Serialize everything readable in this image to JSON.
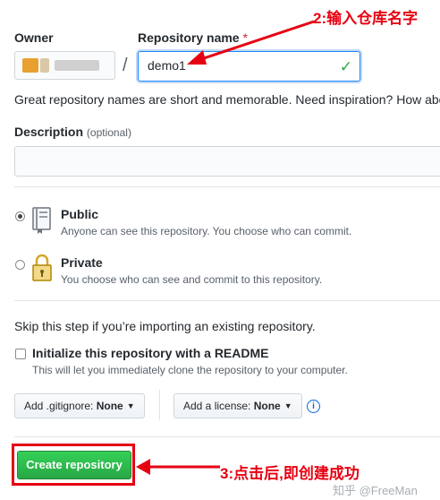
{
  "owner": {
    "label": "Owner"
  },
  "repo": {
    "label": "Repository name",
    "required_mark": "*",
    "value": "demo1",
    "separator": "/"
  },
  "hint": "Great repository names are short and memorable. Need inspiration? How abo",
  "description": {
    "label": "Description",
    "optional": "(optional)"
  },
  "visibility": {
    "public": {
      "title": "Public",
      "desc": "Anyone can see this repository. You choose who can commit.",
      "checked": true
    },
    "private": {
      "title": "Private",
      "desc": "You choose who can see and commit to this repository.",
      "checked": false
    }
  },
  "skip_note": "Skip this step if you’re importing an existing repository.",
  "readme": {
    "label": "Initialize this repository with a README",
    "desc": "This will let you immediately clone the repository to your computer."
  },
  "gitignore": {
    "prefix": "Add .gitignore:",
    "value": "None"
  },
  "license": {
    "prefix": "Add a license:",
    "value": "None"
  },
  "info_icon_glyph": "i",
  "create_button": "Create repository",
  "annotations": {
    "step2": "2:输入仓库名字",
    "step3": "3:点击后,即创建成功"
  },
  "watermark": "知乎 @FreeMan",
  "colors": {
    "accent": "#2188ff",
    "success": "#28a745",
    "annotation": "#e60012"
  }
}
